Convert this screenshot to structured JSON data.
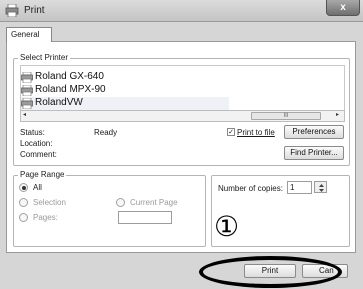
{
  "window": {
    "title": "Print",
    "close_label": "x"
  },
  "tabs": [
    {
      "label": "General"
    }
  ],
  "select_printer": {
    "legend": "Select Printer",
    "printers": [
      {
        "name": "Roland GX-640",
        "icon": "printer-icon"
      },
      {
        "name": "Roland MPX-90",
        "icon": "printer-icon"
      },
      {
        "name": "RolandVW",
        "icon": "printer-icon",
        "selected": true
      }
    ],
    "scroll_thumb": "III",
    "status_label": "Status:",
    "status_value": "Ready",
    "location_label": "Location:",
    "comment_label": "Comment:",
    "print_to_file_label": "Print to file",
    "print_to_file_checked": true,
    "preferences_label": "Preferences",
    "find_printer_label": "Find Printer..."
  },
  "page_range": {
    "legend": "Page Range",
    "all_label": "All",
    "selection_label": "Selection",
    "current_page_label": "Current Page",
    "pages_label": "Pages:",
    "pages_value": "",
    "selected": "All"
  },
  "copies": {
    "label": "Number of copies:",
    "value": "1"
  },
  "annotation": {
    "step_number": "①"
  },
  "buttons": {
    "print_label": "Print",
    "cancel_label": "Can"
  }
}
